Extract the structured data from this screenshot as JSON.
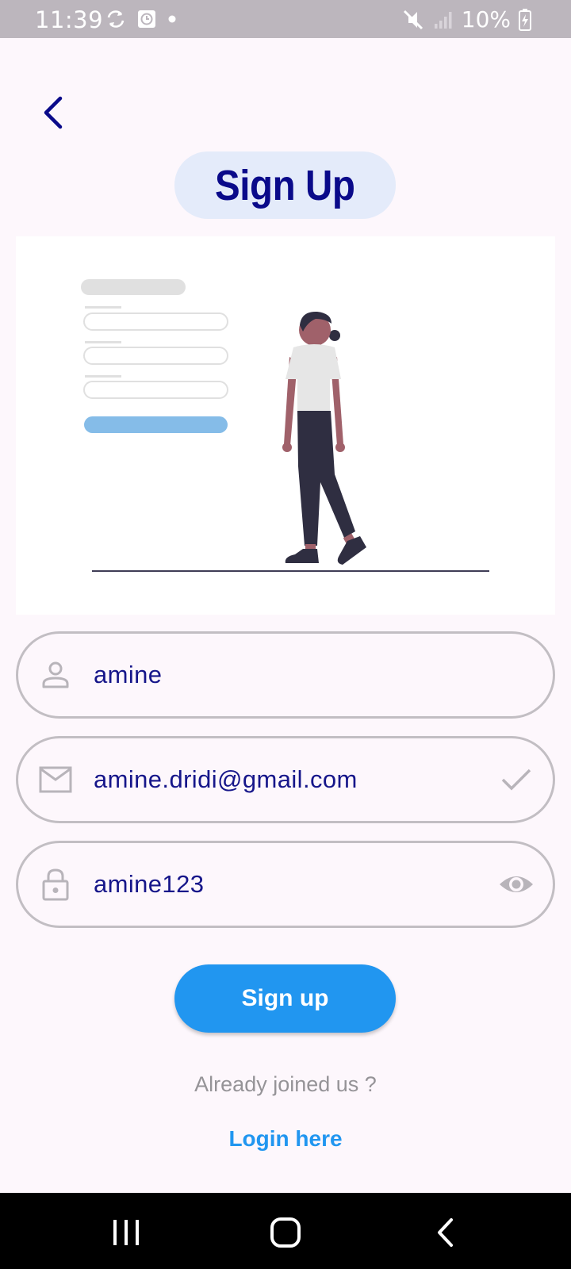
{
  "status_bar": {
    "time": "11:39",
    "battery": "10%",
    "left_icons": [
      "sync-icon",
      "clock-app-icon",
      "dot-icon"
    ],
    "right_icons": [
      "mute-icon",
      "signal-icon",
      "battery-charging-icon"
    ]
  },
  "header": {
    "back_icon": "chevron-left-icon",
    "title": "Sign Up"
  },
  "illustration": {
    "description_icon": "signup-form-person-illustration",
    "colors": {
      "skin": "#a0616a",
      "shirt": "#e6e6e6",
      "pants": "#2f2e41",
      "button": "#85bce8",
      "form_lines": "#e0e0e0"
    }
  },
  "form": {
    "username": {
      "icon": "person-icon",
      "value": "amine"
    },
    "email": {
      "icon": "mail-icon",
      "value": "amine.dridi@gmail.com",
      "trailing_icon": "check-icon"
    },
    "password": {
      "icon": "lock-icon",
      "value": "amine123",
      "trailing_icon": "eye-icon"
    }
  },
  "actions": {
    "signup_label": "Sign up",
    "already_text": "Already joined us ?",
    "login_label": "Login here"
  },
  "nav_bar": {
    "icons": [
      "recent-apps-icon",
      "home-icon",
      "back-icon"
    ]
  },
  "colors": {
    "accent": "#2196f0",
    "title_text": "#0a0a8a",
    "title_pill": "#e4ebfa",
    "background": "#fdf7fc",
    "field_border": "#c2bec3"
  }
}
